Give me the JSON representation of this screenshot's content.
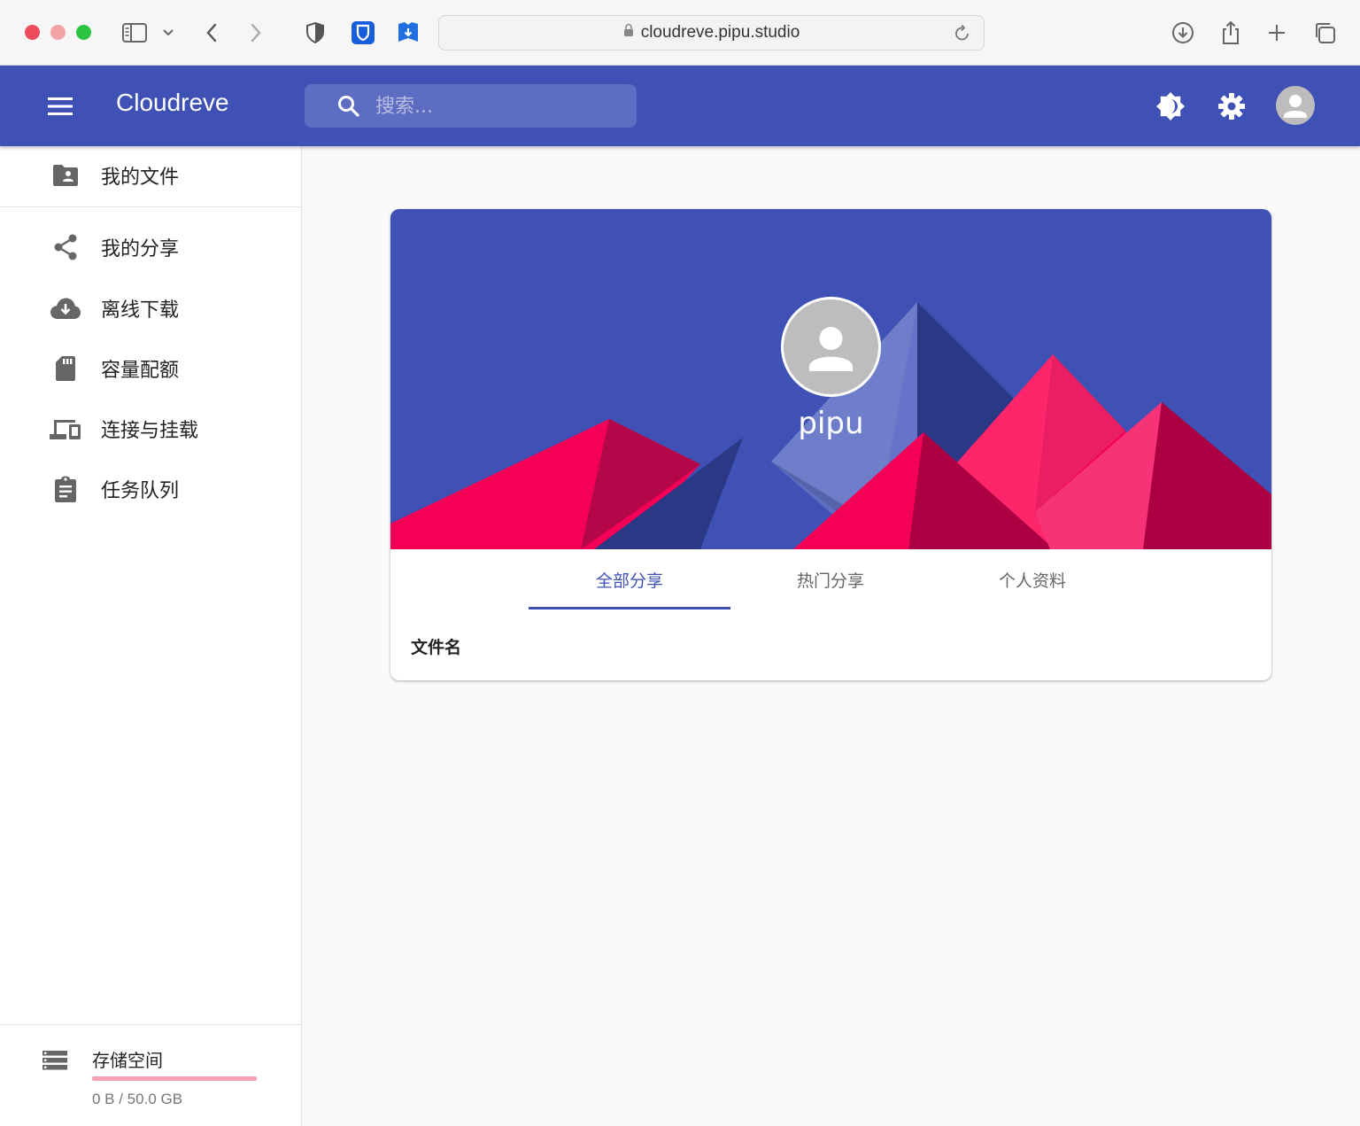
{
  "browser": {
    "url": "cloudreve.pipu.studio"
  },
  "appbar": {
    "title": "Cloudreve",
    "search_placeholder": "搜索..."
  },
  "sidebar": {
    "items": [
      {
        "label": "我的文件",
        "icon": "folder-account-icon"
      },
      {
        "label": "我的分享",
        "icon": "share-icon"
      },
      {
        "label": "离线下载",
        "icon": "cloud-download-icon"
      },
      {
        "label": "容量配额",
        "icon": "sd-card-icon"
      },
      {
        "label": "连接与挂载",
        "icon": "devices-icon"
      },
      {
        "label": "任务队列",
        "icon": "clipboard-list-icon"
      }
    ],
    "storage": {
      "title": "存储空间",
      "usage_text": "0 B / 50.0 GB",
      "used_fraction": 0
    }
  },
  "profile": {
    "username": "pipu",
    "tabs": [
      {
        "label": "全部分享",
        "active": true
      },
      {
        "label": "热门分享",
        "active": false
      },
      {
        "label": "个人资料",
        "active": false
      }
    ],
    "table_header": "文件名"
  },
  "colors": {
    "primary": "#3f51b5",
    "accent": "#e91e63"
  }
}
